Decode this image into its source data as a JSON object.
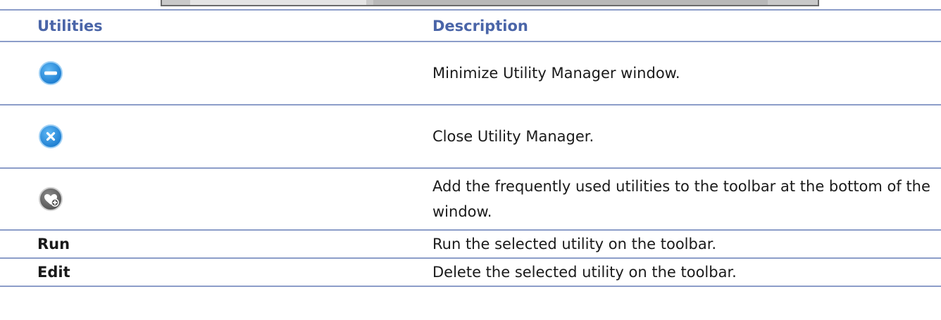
{
  "table": {
    "headers": [
      "Utilities",
      "Description"
    ],
    "rows": [
      {
        "utility_icon": "minimize-icon",
        "description": "Minimize Utility Manager window."
      },
      {
        "utility_icon": "close-icon",
        "description": "Close Utility Manager."
      },
      {
        "utility_icon": "add-favorite-icon",
        "description": "Add the frequently used utilities to the toolbar at the bottom of the window."
      },
      {
        "utility": "Run",
        "description": "Run the selected utility on the toolbar."
      },
      {
        "utility": "Edit",
        "description": "Delete the selected utility on the toolbar."
      }
    ]
  },
  "colors": {
    "header_text": "#4a65a8",
    "rule": "#8c9dc9",
    "icon_blue": "#1e8fe0",
    "icon_gray": "#6f6f6f"
  }
}
